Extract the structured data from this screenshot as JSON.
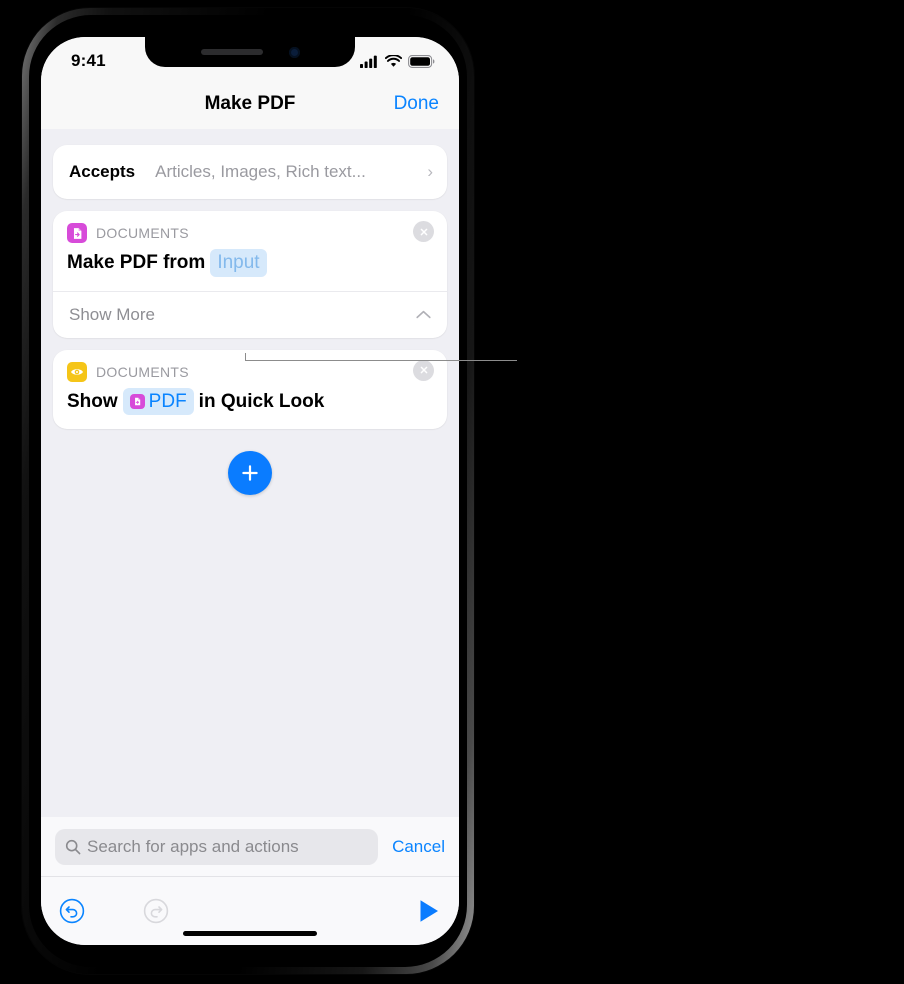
{
  "status_bar": {
    "time": "9:41",
    "signal_icon": "cellular-bars-icon",
    "wifi_icon": "wifi-icon",
    "battery_icon": "battery-full-icon"
  },
  "nav_bar": {
    "title": "Make PDF",
    "done_label": "Done"
  },
  "accepts": {
    "label": "Accepts",
    "value": "Articles, Images, Rich text...",
    "chevron_icon": "chevron-right-icon"
  },
  "actions": [
    {
      "category": "DOCUMENTS",
      "icon_name": "document-make-pdf-icon",
      "icon_color": "#D74BD9",
      "close_icon": "close-circle-icon",
      "text_parts": [
        {
          "type": "text",
          "value": "Make PDF from"
        },
        {
          "type": "token",
          "value": "Input"
        }
      ],
      "show_more_label": "Show More",
      "show_more_chevron": "chevron-up-icon"
    },
    {
      "category": "DOCUMENTS",
      "icon_name": "quick-look-eye-icon",
      "icon_color": "#F5C518",
      "close_icon": "close-circle-icon",
      "text_parts": [
        {
          "type": "text",
          "value": "Show"
        },
        {
          "type": "token_icon",
          "value": "PDF"
        },
        {
          "type": "text",
          "value": "in Quick Look"
        }
      ]
    }
  ],
  "add_button": {
    "label": "+",
    "icon_name": "plus-icon",
    "color": "#0A7CFF"
  },
  "search": {
    "placeholder": "Search for apps and actions",
    "value": "",
    "search_icon": "search-icon",
    "cancel_label": "Cancel"
  },
  "toolbar": {
    "undo_icon": "undo-icon",
    "redo_icon": "redo-icon",
    "run_icon": "play-icon",
    "undo_color": "#0A84FF",
    "redo_color": "#D1D1D6",
    "run_color": "#0A7CFF"
  },
  "colors": {
    "accent_blue": "#0A84FF",
    "background": "#EFEFF4",
    "card": "#FFFFFF",
    "token_bg": "#D6E9FB"
  }
}
